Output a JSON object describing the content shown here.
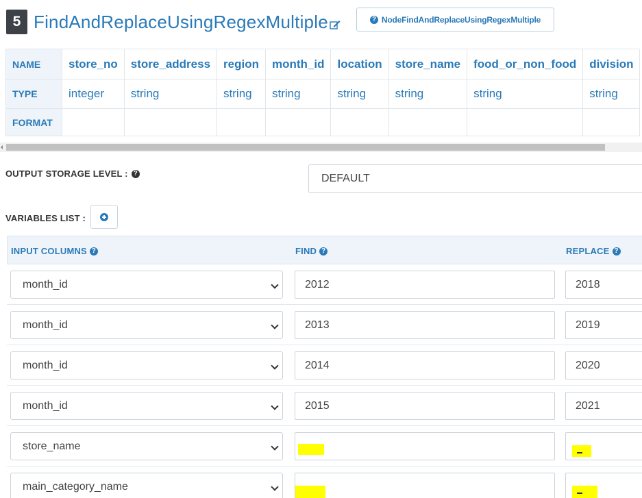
{
  "header": {
    "step": "5",
    "title": "FindAndReplaceUsingRegexMultiple",
    "node_button": "NodeFindAndReplaceUsingRegexMultiple"
  },
  "schema": {
    "row_labels": {
      "name": "NAME",
      "type": "TYPE",
      "format": "FORMAT"
    },
    "columns": [
      {
        "name": "store_no",
        "type": "integer",
        "format": ""
      },
      {
        "name": "store_address",
        "type": "string",
        "format": ""
      },
      {
        "name": "region",
        "type": "string",
        "format": ""
      },
      {
        "name": "month_id",
        "type": "string",
        "format": ""
      },
      {
        "name": "location",
        "type": "string",
        "format": ""
      },
      {
        "name": "store_name",
        "type": "string",
        "format": ""
      },
      {
        "name": "food_or_non_food",
        "type": "string",
        "format": ""
      },
      {
        "name": "division",
        "type": "string",
        "format": ""
      }
    ]
  },
  "output_storage": {
    "label": "OUTPUT STORAGE LEVEL :",
    "value": "DEFAULT"
  },
  "variables": {
    "label": "VARIABLES LIST :",
    "headers": {
      "input": "INPUT COLUMNS",
      "find": "FIND",
      "replace": "REPLACE"
    },
    "rows": [
      {
        "input": "month_id",
        "find": "2012",
        "replace": "2018"
      },
      {
        "input": "month_id",
        "find": "2013",
        "replace": "2019"
      },
      {
        "input": "month_id",
        "find": "2014",
        "replace": "2020"
      },
      {
        "input": "month_id",
        "find": "2015",
        "replace": "2021"
      },
      {
        "input": "store_name",
        "find": "",
        "replace": ""
      },
      {
        "input": "main_category_name",
        "find": "",
        "replace": ""
      }
    ]
  },
  "colors": {
    "accent": "#2a7ab8",
    "highlight": "#ffff00",
    "badge": "#3d4148"
  }
}
